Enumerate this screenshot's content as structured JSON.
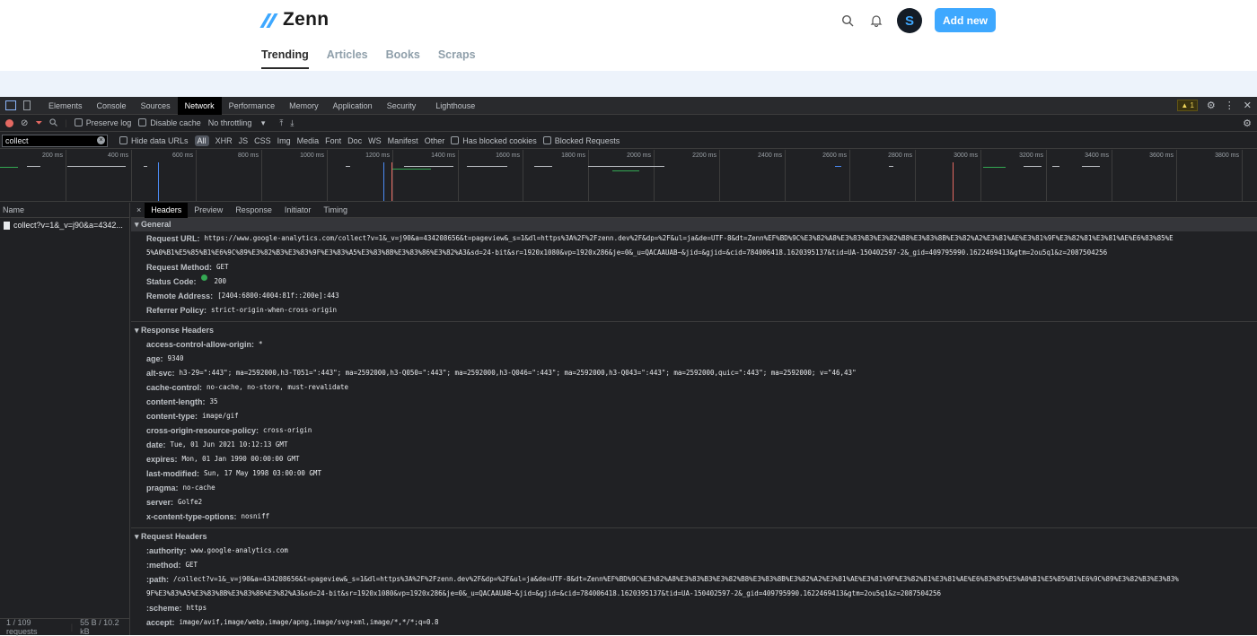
{
  "site": {
    "logo_text": "Zenn",
    "avatar_letter": "S",
    "add_new_label": "Add new",
    "nav": [
      "Trending",
      "Articles",
      "Books",
      "Scraps"
    ]
  },
  "devtools": {
    "tabs": [
      "Elements",
      "Console",
      "Sources",
      "Network",
      "Performance",
      "Memory",
      "Application",
      "Security",
      "Lighthouse"
    ],
    "warning_count": "1",
    "toolbar": {
      "preserve_log": "Preserve log",
      "disable_cache": "Disable cache",
      "throttling": "No throttling"
    },
    "filter": {
      "value": "collect",
      "hide_data_urls": "Hide data URLs",
      "types": [
        "All",
        "XHR",
        "JS",
        "CSS",
        "Img",
        "Media",
        "Font",
        "Doc",
        "WS",
        "Manifest",
        "Other"
      ],
      "has_blocked_cookies": "Has blocked cookies",
      "blocked_requests": "Blocked Requests"
    },
    "timeline_ticks": [
      "200 ms",
      "400 ms",
      "600 ms",
      "800 ms",
      "1000 ms",
      "1200 ms",
      "1400 ms",
      "1600 ms",
      "1800 ms",
      "2000 ms",
      "2200 ms",
      "2400 ms",
      "2600 ms",
      "2800 ms",
      "3000 ms",
      "3200 ms",
      "3400 ms",
      "3600 ms",
      "3800 ms"
    ],
    "request_list": {
      "header": "Name",
      "item": "collect?v=1&_v=j90&a=4342...",
      "footer_requests": "1 / 109 requests",
      "footer_size": "55 B / 10.2 kB"
    },
    "detail_tabs": [
      "Headers",
      "Preview",
      "Response",
      "Initiator",
      "Timing"
    ],
    "general": {
      "title": "General",
      "rows": [
        {
          "k": "Request URL:",
          "v": "https://www.google-analytics.com/collect?v=1&_v=j90&a=434208656&t=pageview&_s=1&dl=https%3A%2F%2Fzenn.dev%2F&dp=%2F&ul=ja&de=UTF-8&dt=Zenn%EF%BD%9C%E3%82%A8%E3%83%B3%E3%82%B8%E3%83%8B%E3%82%A2%E3%81%AE%E3%81%9F%E3%82%81%E3%81%AE%E6%83%85%E"
        },
        {
          "k": "",
          "v": "5%A0%B1%E5%85%B1%E6%9C%89%E3%82%B3%E3%83%9F%E3%83%A5%E3%83%8B%E3%83%86%E3%82%A3&sd=24-bit&sr=1920x1080&vp=1920x286&je=0&_u=QACAAUAB~&jid=&gjid=&cid=784006418.1620395137&tid=UA-150402597-2&_gid=409795990.1622469413&gtm=2ou5q1&z=2087504256"
        },
        {
          "k": "Request Method:",
          "v": "GET"
        },
        {
          "k": "Status Code:",
          "v": "200"
        },
        {
          "k": "Remote Address:",
          "v": "[2404:6800:4004:81f::200e]:443"
        },
        {
          "k": "Referrer Policy:",
          "v": "strict-origin-when-cross-origin"
        }
      ]
    },
    "response_headers": {
      "title": "Response Headers",
      "rows": [
        {
          "k": "access-control-allow-origin:",
          "v": "*"
        },
        {
          "k": "age:",
          "v": "9340"
        },
        {
          "k": "alt-svc:",
          "v": "h3-29=\":443\"; ma=2592000,h3-T051=\":443\"; ma=2592000,h3-Q050=\":443\"; ma=2592000,h3-Q046=\":443\"; ma=2592000,h3-Q043=\":443\"; ma=2592000,quic=\":443\"; ma=2592000; v=\"46,43\""
        },
        {
          "k": "cache-control:",
          "v": "no-cache, no-store, must-revalidate"
        },
        {
          "k": "content-length:",
          "v": "35"
        },
        {
          "k": "content-type:",
          "v": "image/gif"
        },
        {
          "k": "cross-origin-resource-policy:",
          "v": "cross-origin"
        },
        {
          "k": "date:",
          "v": "Tue, 01 Jun 2021 10:12:13 GMT"
        },
        {
          "k": "expires:",
          "v": "Mon, 01 Jan 1990 00:00:00 GMT"
        },
        {
          "k": "last-modified:",
          "v": "Sun, 17 May 1998 03:00:00 GMT"
        },
        {
          "k": "pragma:",
          "v": "no-cache"
        },
        {
          "k": "server:",
          "v": "Golfe2"
        },
        {
          "k": "x-content-type-options:",
          "v": "nosniff"
        }
      ]
    },
    "request_headers": {
      "title": "Request Headers",
      "rows": [
        {
          "k": ":authority:",
          "v": "www.google-analytics.com"
        },
        {
          "k": ":method:",
          "v": "GET"
        },
        {
          "k": ":path:",
          "v": "/collect?v=1&_v=j90&a=434208656&t=pageview&_s=1&dl=https%3A%2F%2Fzenn.dev%2F&dp=%2F&ul=ja&de=UTF-8&dt=Zenn%EF%BD%9C%E3%82%A8%E3%83%B3%E3%82%B8%E3%83%8B%E3%82%A2%E3%81%AE%E3%81%9F%E3%82%81%E3%81%AE%E6%83%85%E5%A0%B1%E5%85%B1%E6%9C%89%E3%82%B3%E3%83%"
        },
        {
          "k": "",
          "v": "9F%E3%83%A5%E3%83%8B%E3%83%86%E3%82%A3&sd=24-bit&sr=1920x1080&vp=1920x286&je=0&_u=QACAAUAB~&jid=&gjid=&cid=784006418.1620395137&tid=UA-150402597-2&_gid=409795990.1622469413&gtm=2ou5q1&z=2087504256"
        },
        {
          "k": ":scheme:",
          "v": "https"
        },
        {
          "k": "accept:",
          "v": "image/avif,image/webp,image/apng,image/svg+xml,image/*,*/*;q=0.8"
        }
      ]
    }
  },
  "colors": {
    "brand": "#3ea8ff",
    "devtools_bg": "#202124",
    "status_ok": "#34a853",
    "timeline_blue": "#4b8bf5",
    "timeline_red": "#e46962"
  }
}
